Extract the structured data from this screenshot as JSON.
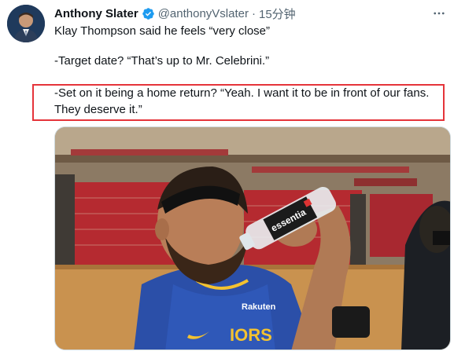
{
  "tweet": {
    "author_name": "Anthony Slater",
    "handle": "@anthonyVslater",
    "separator": "·",
    "time": "15分钟",
    "lines": [
      "Klay Thompson said he feels “very close”",
      "-Target date? “That’s up to Mr. Celebrini.”",
      "-Set on it being a home return? “Yeah. I want it to be in front of our fans.",
      "They deserve it.”"
    ],
    "more_icon": "ellipsis-icon",
    "verified_icon": "verified-badge-icon",
    "media_labels": {
      "bottle_brand": "essentia",
      "jersey_text": "IORS",
      "sponsor_text": "Rakuten"
    }
  },
  "colors": {
    "verified": "#1d9bf0",
    "highlight": "#e5343a",
    "muted_text": "#536471"
  }
}
